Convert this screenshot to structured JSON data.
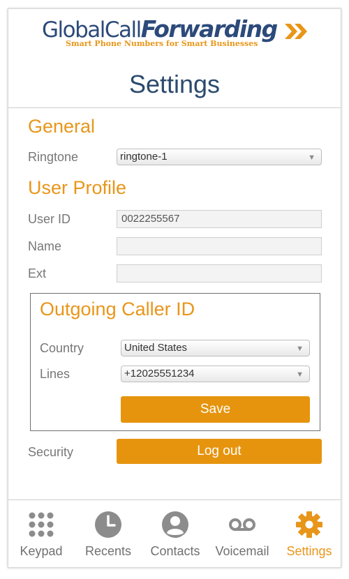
{
  "brand": {
    "logo_part1": "GlobalCall",
    "logo_part2": "Forwarding",
    "tagline": "Smart Phone Numbers for Smart Businesses",
    "colors": {
      "navy": "#2c4a7a",
      "orange": "#e8961a"
    }
  },
  "header": {
    "title": "Settings"
  },
  "general": {
    "heading": "General",
    "ringtone_label": "Ringtone",
    "ringtone_value": "ringtone-1"
  },
  "user_profile": {
    "heading": "User Profile",
    "user_id_label": "User ID",
    "user_id_value": "0022255567",
    "name_label": "Name",
    "name_value": "",
    "ext_label": "Ext",
    "ext_value": ""
  },
  "outgoing_caller_id": {
    "heading": "Outgoing Caller ID",
    "country_label": "Country",
    "country_value": "United States",
    "lines_label": "Lines",
    "lines_value": "+12025551234",
    "save_label": "Save"
  },
  "security": {
    "label": "Security",
    "logout_label": "Log out"
  },
  "bottom_nav": {
    "items": [
      {
        "label": "Keypad",
        "icon": "keypad-icon"
      },
      {
        "label": "Recents",
        "icon": "clock-icon"
      },
      {
        "label": "Contacts",
        "icon": "person-icon"
      },
      {
        "label": "Voicemail",
        "icon": "voicemail-icon"
      },
      {
        "label": "Settings",
        "icon": "gear-icon",
        "active": true
      }
    ],
    "active_color": "#e8961a",
    "inactive_color": "#8c8c8c"
  }
}
